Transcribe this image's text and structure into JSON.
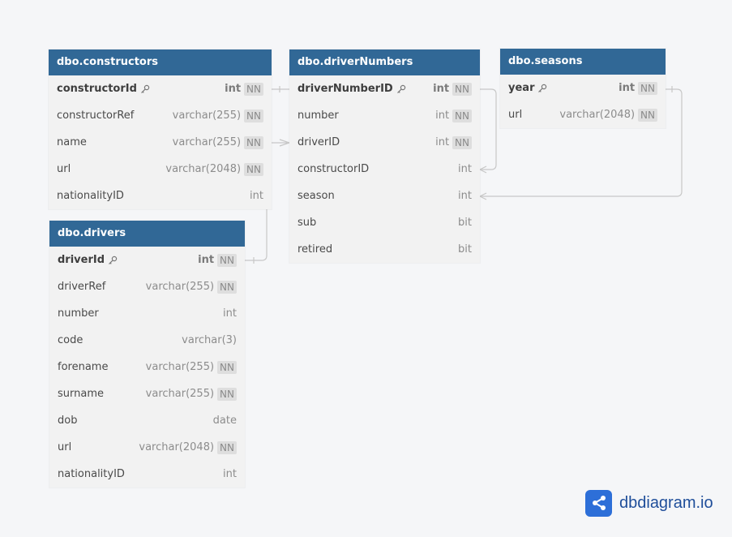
{
  "tables": [
    {
      "id": "constructors",
      "title": "dbo.constructors",
      "fields": [
        {
          "name": "constructorId",
          "type": "int",
          "nn": "NN",
          "pk": true
        },
        {
          "name": "constructorRef",
          "type": "varchar(255)",
          "nn": "NN"
        },
        {
          "name": "name",
          "type": "varchar(255)",
          "nn": "NN"
        },
        {
          "name": "url",
          "type": "varchar(2048)",
          "nn": "NN"
        },
        {
          "name": "nationalityID",
          "type": "int",
          "nn": ""
        }
      ]
    },
    {
      "id": "driverNumbers",
      "title": "dbo.driverNumbers",
      "fields": [
        {
          "name": "driverNumberID",
          "type": "int",
          "nn": "NN",
          "pk": true
        },
        {
          "name": "number",
          "type": "int",
          "nn": "NN"
        },
        {
          "name": "driverID",
          "type": "int",
          "nn": "NN"
        },
        {
          "name": "constructorID",
          "type": "int",
          "nn": ""
        },
        {
          "name": "season",
          "type": "int",
          "nn": ""
        },
        {
          "name": "sub",
          "type": "bit",
          "nn": ""
        },
        {
          "name": "retired",
          "type": "bit",
          "nn": ""
        }
      ]
    },
    {
      "id": "seasons",
      "title": "dbo.seasons",
      "fields": [
        {
          "name": "year",
          "type": "int",
          "nn": "NN",
          "pk": true
        },
        {
          "name": "url",
          "type": "varchar(2048)",
          "nn": "NN"
        }
      ]
    },
    {
      "id": "drivers",
      "title": "dbo.drivers",
      "fields": [
        {
          "name": "driverId",
          "type": "int",
          "nn": "NN",
          "pk": true
        },
        {
          "name": "driverRef",
          "type": "varchar(255)",
          "nn": "NN"
        },
        {
          "name": "number",
          "type": "int",
          "nn": ""
        },
        {
          "name": "code",
          "type": "varchar(3)",
          "nn": ""
        },
        {
          "name": "forename",
          "type": "varchar(255)",
          "nn": "NN"
        },
        {
          "name": "surname",
          "type": "varchar(255)",
          "nn": "NN"
        },
        {
          "name": "dob",
          "type": "date",
          "nn": ""
        },
        {
          "name": "url",
          "type": "varchar(2048)",
          "nn": "NN"
        },
        {
          "name": "nationalityID",
          "type": "int",
          "nn": ""
        }
      ]
    }
  ],
  "relationships": [
    {
      "from": "constructors.constructorId",
      "to": "driverNumbers.constructorID"
    },
    {
      "from": "drivers.driverId",
      "to": "driverNumbers.driverID"
    },
    {
      "from": "seasons.year",
      "to": "driverNumbers.season"
    }
  ],
  "brand": {
    "name": "dbdiagram.io",
    "logo_icon": "share-nodes-icon",
    "logo_color": "#2d6fd8"
  },
  "colors": {
    "header": "#316896",
    "body": "#f2f2f2",
    "edge": "#c7c7c7"
  }
}
